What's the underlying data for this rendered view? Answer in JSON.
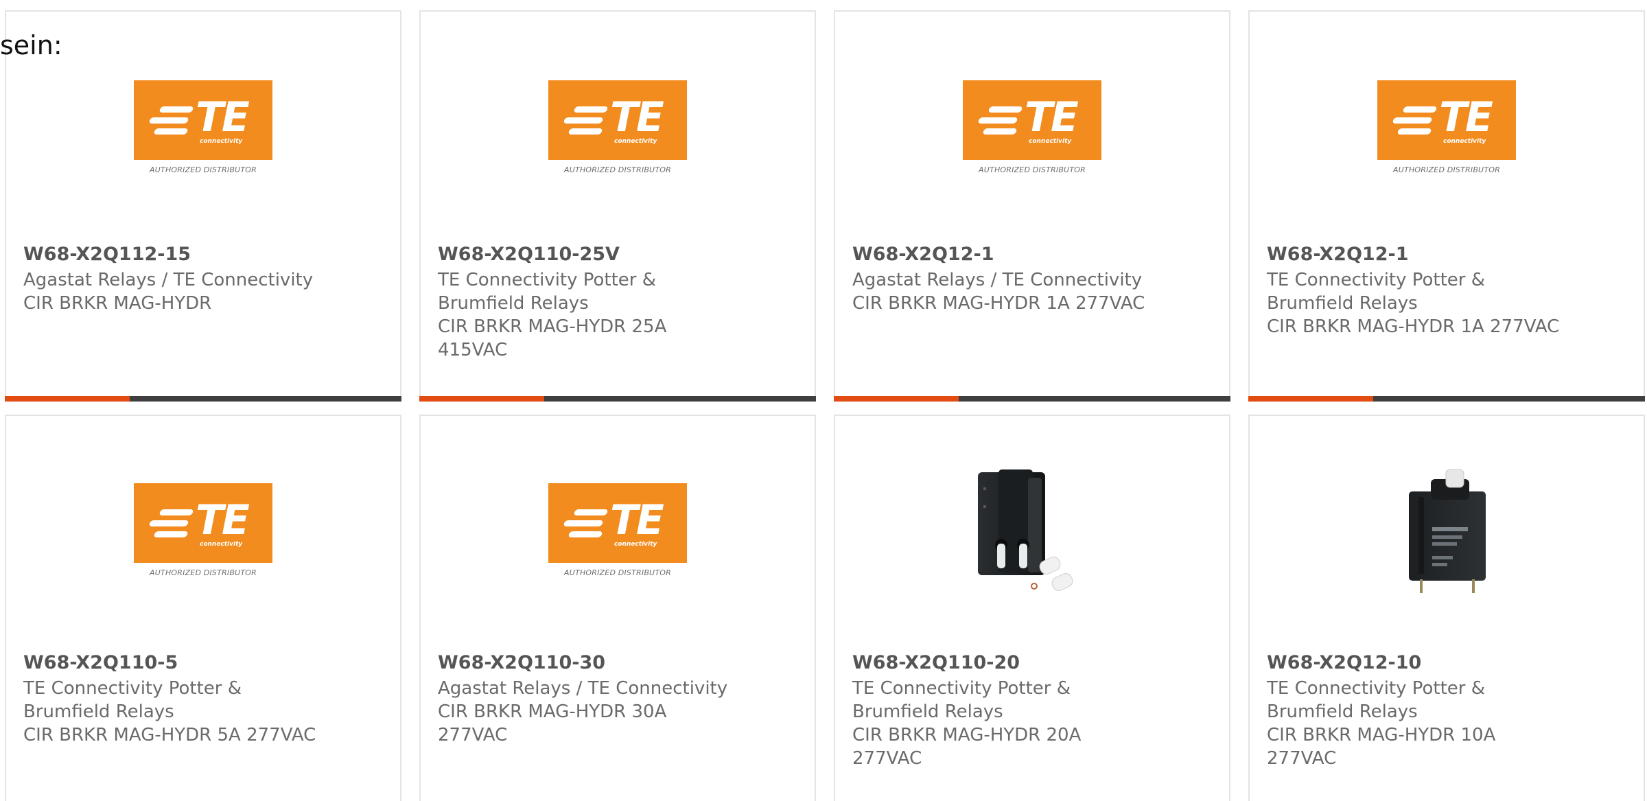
{
  "prefix_label": "sein:",
  "logo": {
    "brand": "TE",
    "tagline": "connectivity",
    "authorized_text": "AUTHORIZED DISTRIBUTOR",
    "icon": "te-connectivity-logo",
    "brand_color": "#f28c1f"
  },
  "accent_colors": {
    "accent": "#e24b12",
    "bar": "#3f3f3f"
  },
  "products": [
    {
      "part_number": "W68-X2Q112-15",
      "manufacturer_lines": [
        "Agastat Relays / TE Connectivity"
      ],
      "description_lines": [
        "CIR BRKR MAG-HYDR"
      ],
      "image": "te-authorized-distributor-logo"
    },
    {
      "part_number": "W68-X2Q110-25V",
      "manufacturer_lines": [
        "TE Connectivity Potter &",
        "Brumfield Relays"
      ],
      "description_lines": [
        "CIR BRKR MAG-HYDR 25A",
        "415VAC"
      ],
      "image": "te-authorized-distributor-logo"
    },
    {
      "part_number": "W68-X2Q12-1",
      "manufacturer_lines": [
        "Agastat Relays / TE Connectivity"
      ],
      "description_lines": [
        "CIR BRKR MAG-HYDR 1A 277VAC"
      ],
      "image": "te-authorized-distributor-logo"
    },
    {
      "part_number": "W68-X2Q12-1",
      "manufacturer_lines": [
        "TE Connectivity Potter &",
        "Brumfield Relays"
      ],
      "description_lines": [
        "CIR BRKR MAG-HYDR 1A 277VAC"
      ],
      "image": "te-authorized-distributor-logo"
    },
    {
      "part_number": "W68-X2Q110-5",
      "manufacturer_lines": [
        "TE Connectivity Potter &",
        "Brumfield Relays"
      ],
      "description_lines": [
        "CIR BRKR MAG-HYDR 5A 277VAC"
      ],
      "image": "te-authorized-distributor-logo"
    },
    {
      "part_number": "W68-X2Q110-30",
      "manufacturer_lines": [
        "Agastat Relays / TE Connectivity"
      ],
      "description_lines": [
        "CIR BRKR MAG-HYDR 30A",
        "277VAC"
      ],
      "image": "te-authorized-distributor-logo"
    },
    {
      "part_number": "W68-X2Q110-20",
      "manufacturer_lines": [
        "TE Connectivity Potter &",
        "Brumfield Relays"
      ],
      "description_lines": [
        "CIR BRKR MAG-HYDR 20A",
        "277VAC"
      ],
      "image": "circuit-breaker-photo"
    },
    {
      "part_number": "W68-X2Q12-10",
      "manufacturer_lines": [
        "TE Connectivity Potter &",
        "Brumfield Relays"
      ],
      "description_lines": [
        "CIR BRKR MAG-HYDR 10A",
        "277VAC"
      ],
      "image": "circuit-breaker-photo"
    }
  ]
}
